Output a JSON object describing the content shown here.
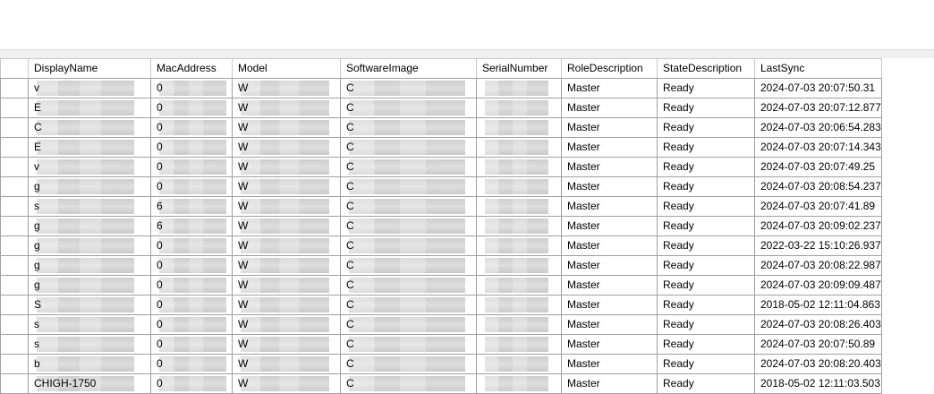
{
  "columns": [
    {
      "key": "row_header",
      "label": ""
    },
    {
      "key": "display_name",
      "label": "DisplayName"
    },
    {
      "key": "mac_address",
      "label": "MacAddress"
    },
    {
      "key": "model",
      "label": "Model"
    },
    {
      "key": "software_image",
      "label": "SoftwareImage"
    },
    {
      "key": "serial_number",
      "label": "SerialNumber"
    },
    {
      "key": "role_description",
      "label": "RoleDescription"
    },
    {
      "key": "state_description",
      "label": "StateDescription"
    },
    {
      "key": "last_sync",
      "label": "LastSync"
    }
  ],
  "rows": [
    {
      "display_name": "v",
      "mac_address": "0",
      "model": "W",
      "software_image": "C",
      "serial_number": "",
      "role_description": "Master",
      "state_description": "Ready",
      "last_sync": "2024-07-03 20:07:50.31"
    },
    {
      "display_name": "E",
      "mac_address": "0",
      "model": "W",
      "software_image": "C",
      "serial_number": "",
      "role_description": "Master",
      "state_description": "Ready",
      "last_sync": "2024-07-03 20:07:12.877"
    },
    {
      "display_name": "C",
      "mac_address": "0",
      "model": "W",
      "software_image": "C",
      "serial_number": "",
      "role_description": "Master",
      "state_description": "Ready",
      "last_sync": "2024-07-03 20:06:54.283"
    },
    {
      "display_name": "E",
      "mac_address": "0",
      "model": "W",
      "software_image": "C",
      "serial_number": "",
      "role_description": "Master",
      "state_description": "Ready",
      "last_sync": "2024-07-03 20:07:14.343"
    },
    {
      "display_name": "v",
      "mac_address": "0",
      "model": "W",
      "software_image": "C",
      "serial_number": "",
      "role_description": "Master",
      "state_description": "Ready",
      "last_sync": "2024-07-03 20:07:49.25"
    },
    {
      "display_name": "g",
      "mac_address": "0",
      "model": "W",
      "software_image": "C",
      "serial_number": "",
      "role_description": "Master",
      "state_description": "Ready",
      "last_sync": "2024-07-03 20:08:54.237"
    },
    {
      "display_name": "s",
      "mac_address": "6",
      "model": "W",
      "software_image": "C",
      "serial_number": "",
      "role_description": "Master",
      "state_description": "Ready",
      "last_sync": "2024-07-03 20:07:41.89"
    },
    {
      "display_name": "g",
      "mac_address": "6",
      "model": "W",
      "software_image": "C",
      "serial_number": "",
      "role_description": "Master",
      "state_description": "Ready",
      "last_sync": "2024-07-03 20:09:02.237"
    },
    {
      "display_name": "g",
      "mac_address": "0",
      "model": "W",
      "software_image": "C",
      "serial_number": "",
      "role_description": "Master",
      "state_description": "Ready",
      "last_sync": "2022-03-22 15:10:26.937"
    },
    {
      "display_name": "g",
      "mac_address": "0",
      "model": "W",
      "software_image": "C",
      "serial_number": "",
      "role_description": "Master",
      "state_description": "Ready",
      "last_sync": "2024-07-03 20:08:22.987"
    },
    {
      "display_name": "g",
      "mac_address": "0",
      "model": "W",
      "software_image": "C",
      "serial_number": "",
      "role_description": "Master",
      "state_description": "Ready",
      "last_sync": "2024-07-03 20:09:09.487"
    },
    {
      "display_name": "S",
      "mac_address": "0",
      "model": "W",
      "software_image": "C",
      "serial_number": "",
      "role_description": "Master",
      "state_description": "Ready",
      "last_sync": "2018-05-02 12:11:04.863"
    },
    {
      "display_name": "s",
      "mac_address": "0",
      "model": "W",
      "software_image": "C",
      "serial_number": "",
      "role_description": "Master",
      "state_description": "Ready",
      "last_sync": "2024-07-03 20:08:26.403"
    },
    {
      "display_name": "s",
      "mac_address": "0",
      "model": "W",
      "software_image": "C",
      "serial_number": "",
      "role_description": "Master",
      "state_description": "Ready",
      "last_sync": "2024-07-03 20:07:50.89"
    },
    {
      "display_name": "b",
      "mac_address": "0",
      "model": "W",
      "software_image": "C",
      "serial_number": "",
      "role_description": "Master",
      "state_description": "Ready",
      "last_sync": "2024-07-03 20:08:20.403"
    },
    {
      "display_name": "CHIGH-1750",
      "mac_address": "0",
      "model": "W",
      "software_image": "C",
      "serial_number": "",
      "role_description": "Master",
      "state_description": "Ready",
      "last_sync": "2018-05-02 12:11:03.503"
    }
  ]
}
